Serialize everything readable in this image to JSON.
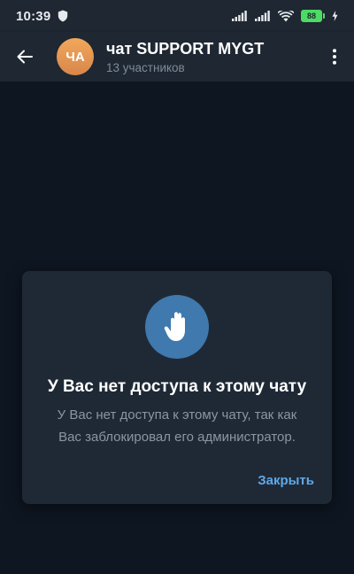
{
  "status_bar": {
    "time": "10:39",
    "battery_level": "88",
    "icons": [
      "shield-icon",
      "signal-icon",
      "signal-icon",
      "wifi-icon",
      "battery-icon",
      "charging-icon"
    ]
  },
  "header": {
    "back_icon": "arrow-left-icon",
    "avatar_initials": "ЧА",
    "title": "чат SUPPORT MYGT",
    "subtitle": "13 участников",
    "menu_icon": "more-vertical-icon"
  },
  "dialog": {
    "icon": "hand-stop-icon",
    "title": "У Вас нет доступа к этому чату",
    "text_line1": "У Вас нет доступа к этому чату, так как",
    "text_line2": "Вас заблокировал его администратор.",
    "close_label": "Закрыть"
  },
  "colors": {
    "header_bg": "#1e2732",
    "chat_bg": "#0e1621",
    "dialog_bg": "#1f2936",
    "accent": "#5fa8e6",
    "icon_circle": "#3f79ad",
    "avatar": "#e89a53",
    "battery": "#4ddb63"
  }
}
